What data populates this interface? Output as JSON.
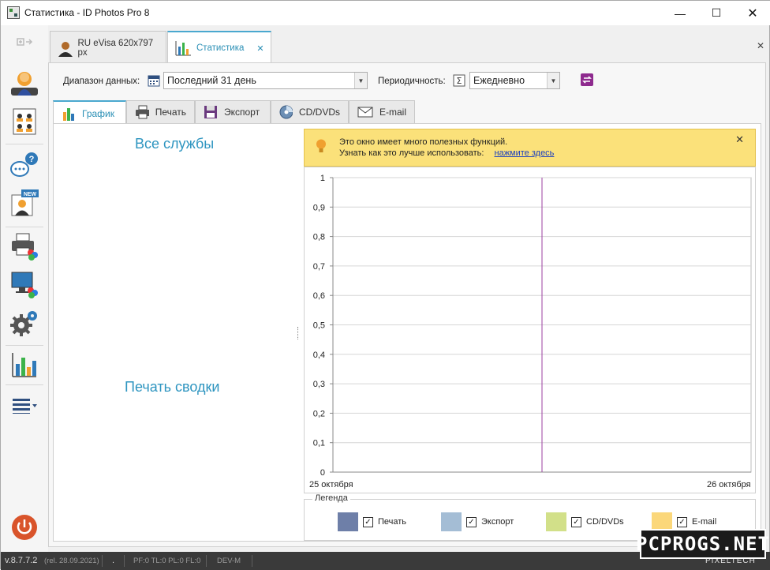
{
  "window": {
    "title": "Статистика - ID Photos Pro 8",
    "min_glyph": "—",
    "max_glyph": "☐",
    "close_glyph": "✕"
  },
  "doc_tabs": [
    {
      "label": "RU eVisa 620x797 px",
      "icon": "user-photo-icon"
    },
    {
      "label": "Статистика",
      "icon": "bar-chart-icon",
      "close": "✕"
    }
  ],
  "panel_close": "✕",
  "toolbar": {
    "range_label": "Диапазон данных:",
    "range_value": "Последний 31 день",
    "period_label": "Периодичность:",
    "period_value": "Ежедневно"
  },
  "sub_tabs": [
    {
      "label": "График",
      "icon": "bar-chart-icon"
    },
    {
      "label": "Печать",
      "icon": "printer-icon"
    },
    {
      "label": "Экспорт",
      "icon": "floppy-disk-icon"
    },
    {
      "label": "CD/DVDs",
      "icon": "disc-icon"
    },
    {
      "label": "E-mail",
      "icon": "envelope-icon"
    }
  ],
  "left": {
    "heading_services": "Все службы",
    "heading_print": "Печать сводки"
  },
  "tip": {
    "line1": "Это окно имеет много полезных функций.",
    "line2": "Узнать как это лучше использовать:",
    "link": "нажмите здесь",
    "close": "✕"
  },
  "chart_data": {
    "type": "line",
    "x_tick_labels": [
      "25 октября",
      "26 октября"
    ],
    "y_ticks": [
      "0",
      "0,1",
      "0,2",
      "0,3",
      "0,4",
      "0,5",
      "0,6",
      "0,7",
      "0,8",
      "0,9",
      "1"
    ],
    "ylim": [
      0,
      1
    ],
    "grid": true,
    "series": [],
    "marker_color": "#9b3fa0"
  },
  "legend": {
    "title": "Легенда",
    "items": [
      {
        "label": "Печать",
        "color": "#6e7fa8",
        "checked": true
      },
      {
        "label": "Экспорт",
        "color": "#a4bdd5",
        "checked": true
      },
      {
        "label": "CD/DVDs",
        "color": "#d2e089",
        "checked": true
      },
      {
        "label": "E-mail",
        "color": "#fbd77a",
        "checked": true
      }
    ]
  },
  "status": {
    "version": "v.8.7.7.2",
    "release": "(rel. 28.09.2021)",
    "dot": ".",
    "counters": "PF:0 TL:0 PL:0 FL:0",
    "mode": "DEV-M",
    "brand": "PIXELTECH"
  },
  "watermark": "PCPROGS.NET"
}
